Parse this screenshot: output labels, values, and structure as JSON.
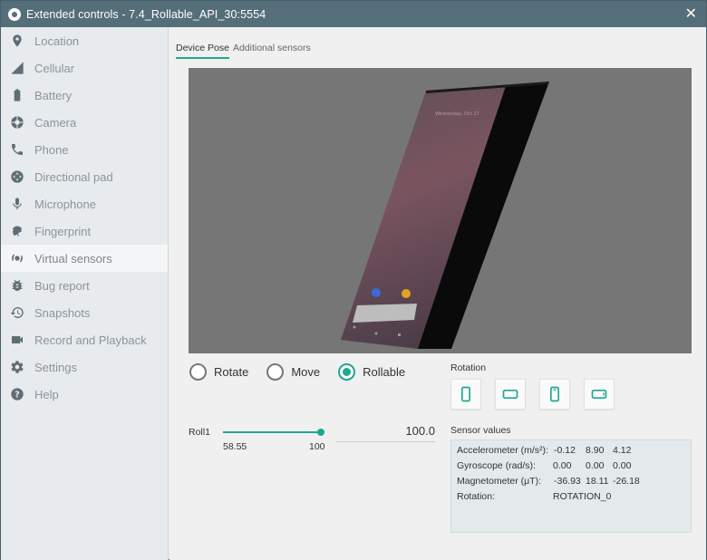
{
  "window": {
    "title": "Extended controls - 7.4_Rollable_API_30:5554",
    "close_glyph": "✕"
  },
  "sidebar": {
    "items": [
      {
        "label": "Location",
        "icon": "location-pin-icon"
      },
      {
        "label": "Cellular",
        "icon": "cellular-signal-icon"
      },
      {
        "label": "Battery",
        "icon": "battery-icon"
      },
      {
        "label": "Camera",
        "icon": "camera-aperture-icon"
      },
      {
        "label": "Phone",
        "icon": "phone-icon"
      },
      {
        "label": "Directional pad",
        "icon": "dpad-icon"
      },
      {
        "label": "Microphone",
        "icon": "microphone-icon"
      },
      {
        "label": "Fingerprint",
        "icon": "fingerprint-icon"
      },
      {
        "label": "Virtual sensors",
        "icon": "virtual-sensors-icon",
        "active": true
      },
      {
        "label": "Bug report",
        "icon": "bug-icon"
      },
      {
        "label": "Snapshots",
        "icon": "history-icon"
      },
      {
        "label": "Record and Playback",
        "icon": "video-camera-icon"
      },
      {
        "label": "Settings",
        "icon": "gear-icon"
      },
      {
        "label": "Help",
        "icon": "help-icon"
      }
    ]
  },
  "tabs": {
    "device_pose": "Device Pose",
    "additional_sensors": "Additional sensors"
  },
  "modes": {
    "rotate": "Rotate",
    "move": "Move",
    "rollable": "Rollable",
    "selected": "Rollable"
  },
  "rotation": {
    "label": "Rotation"
  },
  "roll": {
    "label": "Roll1",
    "min": "58.55",
    "max": "100",
    "value": "100.0",
    "fraction": 1.0
  },
  "sensors": {
    "label": "Sensor values",
    "accelerometer_label": "Accelerometer (m/s²):",
    "accelerometer": [
      "-0.12",
      "8.90",
      "4.12"
    ],
    "gyroscope_label": "Gyroscope (rad/s):",
    "gyroscope": [
      "0.00",
      "0.00",
      "0.00"
    ],
    "magnetometer_label": "Magnetometer (μT):",
    "magnetometer": [
      "-36.93",
      "18.11",
      "-26.18"
    ],
    "rotation_label": "Rotation:",
    "rotation_value": "ROTATION_0"
  },
  "colors": {
    "accent": "#1fa792",
    "titlebar": "#546e7a",
    "viewport_bg": "#767676"
  }
}
